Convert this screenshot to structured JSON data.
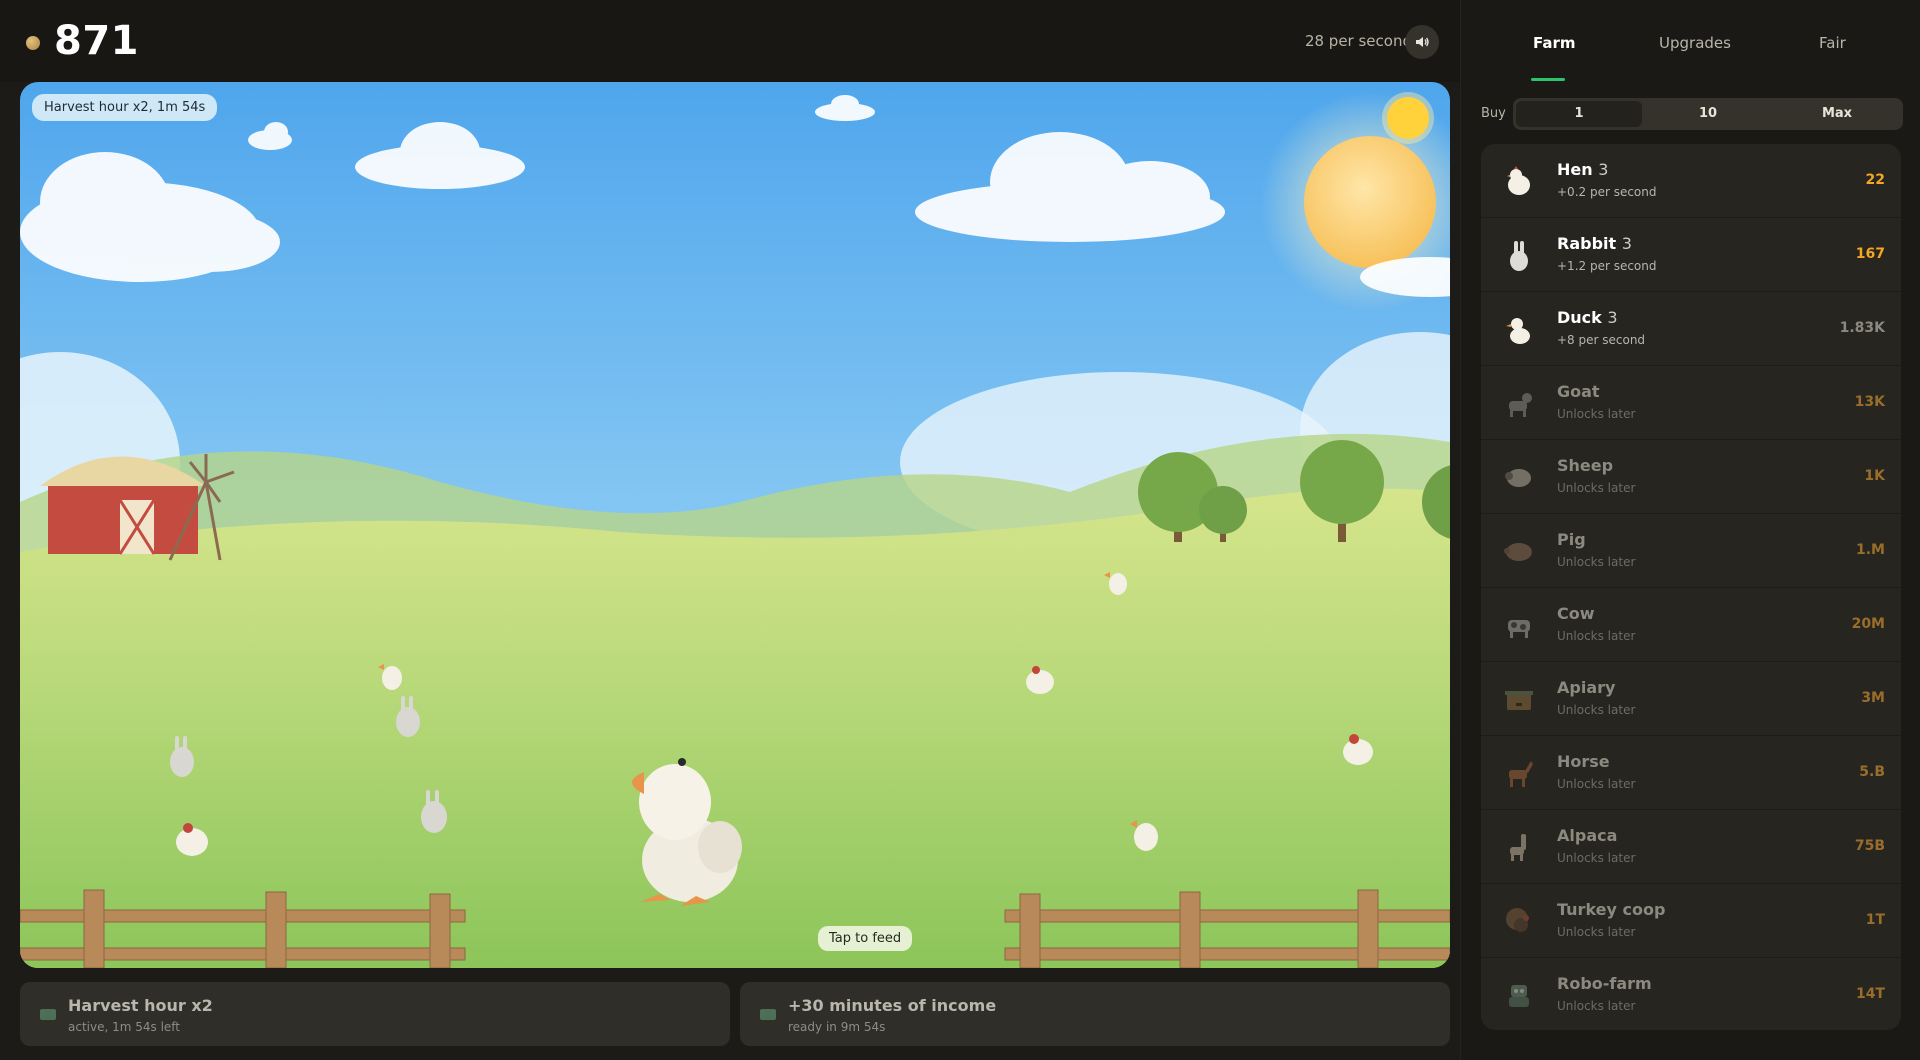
{
  "header": {
    "coins": "871",
    "rate_text": "28 per second",
    "sound_icon": "speaker-icon"
  },
  "scene": {
    "boost_chip": "Harvest hour x2, 1m 54s",
    "tap_hint": "Tap to feed"
  },
  "boosts": [
    {
      "title": "Harvest hour x2",
      "subtitle": "active, 1m 54s left"
    },
    {
      "title": "+30 minutes of income",
      "subtitle": "ready in 9m 54s"
    }
  ],
  "tabs": [
    {
      "label": "Farm",
      "active": true
    },
    {
      "label": "Upgrades",
      "active": false
    },
    {
      "label": "Fair",
      "active": false
    }
  ],
  "buy": {
    "label": "Buy",
    "options": [
      "1",
      "10",
      "Max"
    ],
    "selected": "1"
  },
  "animals": [
    {
      "name": "Hen",
      "count": "3",
      "sub": "+0.2 per second",
      "price": "22",
      "price_color": "#f5a623",
      "locked": false,
      "icon": "hen-icon"
    },
    {
      "name": "Rabbit",
      "count": "3",
      "sub": "+1.2 per second",
      "price": "167",
      "price_color": "#f5a623",
      "locked": false,
      "icon": "rabbit-icon"
    },
    {
      "name": "Duck",
      "count": "3",
      "sub": "+8 per second",
      "price": "1.83K",
      "price_color": "#8c897f",
      "locked": false,
      "icon": "duck-icon"
    },
    {
      "name": "Goat",
      "count": "",
      "sub": "Unlocks later",
      "price": "13K",
      "price_color": "#9a6e2a",
      "locked": true,
      "icon": "goat-icon"
    },
    {
      "name": "Sheep",
      "count": "",
      "sub": "Unlocks later",
      "price": "1K",
      "price_color": "#9a6e2a",
      "locked": true,
      "icon": "sheep-icon"
    },
    {
      "name": "Pig",
      "count": "",
      "sub": "Unlocks later",
      "price": "1.M",
      "price_color": "#9a6e2a",
      "locked": true,
      "icon": "pig-icon"
    },
    {
      "name": "Cow",
      "count": "",
      "sub": "Unlocks later",
      "price": "20M",
      "price_color": "#9a6e2a",
      "locked": true,
      "icon": "cow-icon"
    },
    {
      "name": "Apiary",
      "count": "",
      "sub": "Unlocks later",
      "price": "3M",
      "price_color": "#9a6e2a",
      "locked": true,
      "icon": "beehive-icon"
    },
    {
      "name": "Horse",
      "count": "",
      "sub": "Unlocks later",
      "price": "5.B",
      "price_color": "#9a6e2a",
      "locked": true,
      "icon": "horse-icon"
    },
    {
      "name": "Alpaca",
      "count": "",
      "sub": "Unlocks later",
      "price": "75B",
      "price_color": "#9a6e2a",
      "locked": true,
      "icon": "alpaca-icon"
    },
    {
      "name": "Turkey coop",
      "count": "",
      "sub": "Unlocks later",
      "price": "1T",
      "price_color": "#9a6e2a",
      "locked": true,
      "icon": "turkey-icon"
    },
    {
      "name": "Robo-farm",
      "count": "",
      "sub": "Unlocks later",
      "price": "14T",
      "price_color": "#9a6e2a",
      "locked": true,
      "icon": "robot-icon"
    }
  ],
  "colors": {
    "accent": "#2ec46b",
    "price_active": "#f5a623",
    "price_locked": "#9a6e2a"
  }
}
